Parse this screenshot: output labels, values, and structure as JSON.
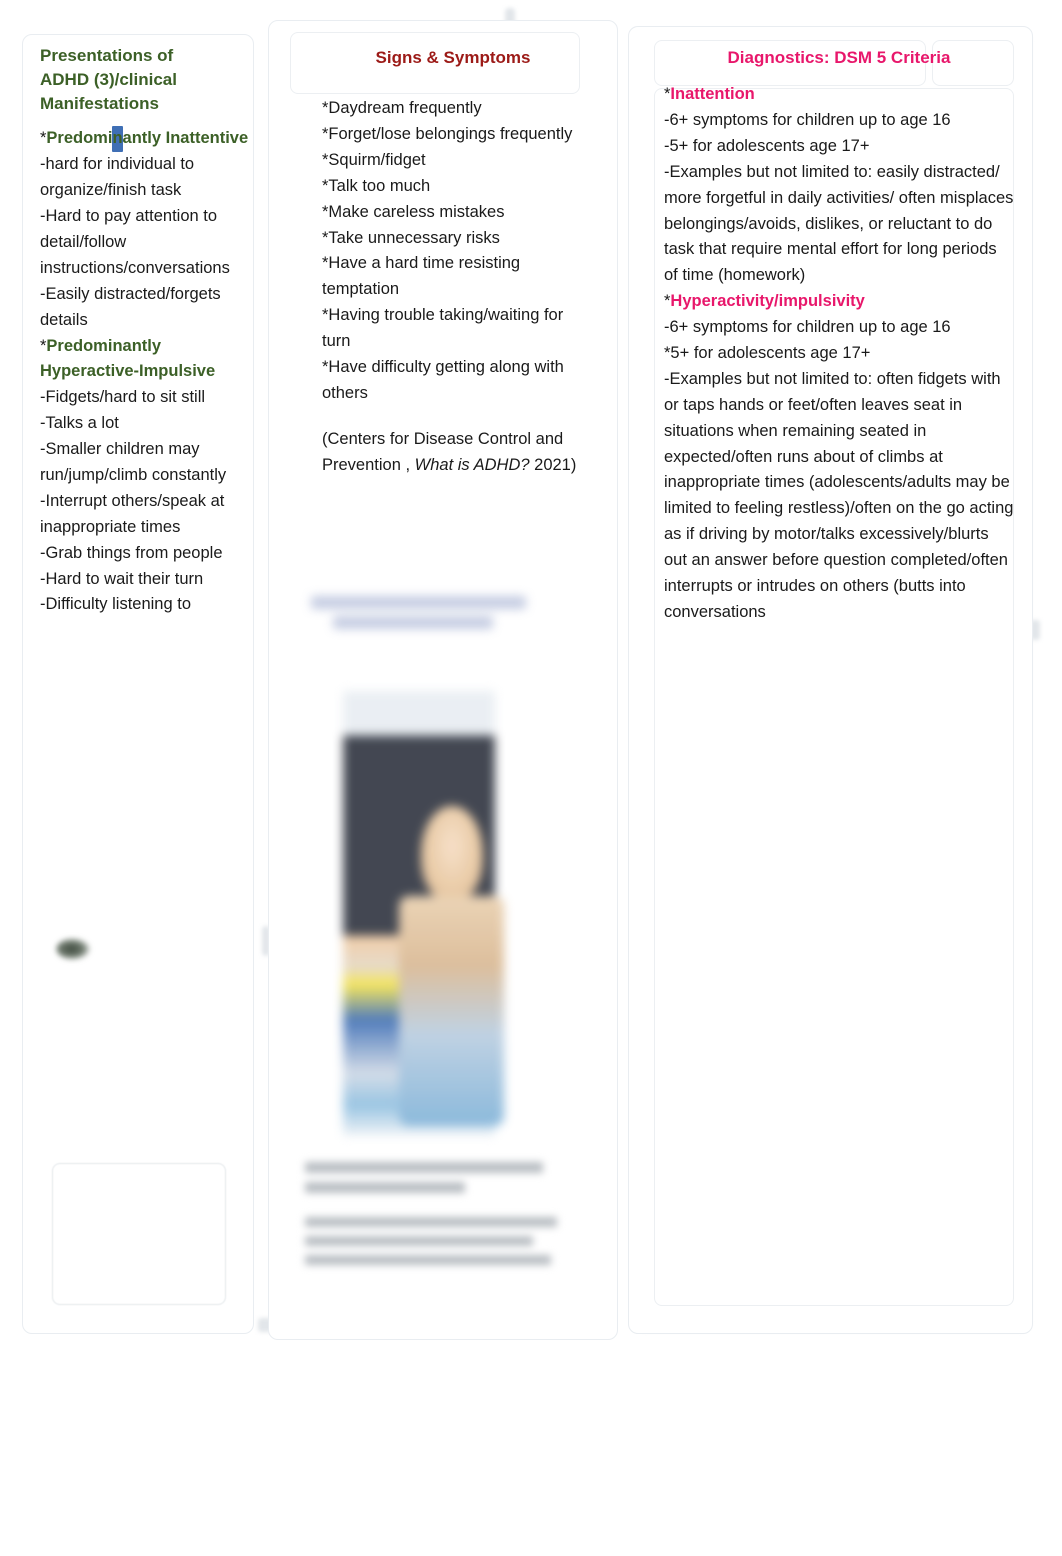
{
  "document": {
    "type": "concept-map-slide",
    "colors": {
      "green_heading": "#3c6027",
      "red_heading": "#9c1a17",
      "pink_heading": "#e8176b",
      "body_text": "#1a1a1a",
      "panel_border": "#e9edf1",
      "selection_highlight": "#3f6fb5"
    }
  },
  "left_column": {
    "title": "Presentations of ADHD (3)/clinical Manifestations",
    "section_1_heading": "Predominantly Inattentive",
    "section_1_items": [
      "-hard for individual to organize/finish task",
      "-Hard to pay attention to detail/follow instructions/conversations",
      "-Easily distracted/forgets details"
    ],
    "section_2_heading": "Predominantly Hyperactive-Impulsive",
    "section_2_items": [
      "-Fidgets/hard to sit still",
      "-Talks a lot",
      "-Smaller children may run/jump/climb constantly",
      "-Interrupt others/speak at inappropriate times",
      "-Grab things from people",
      "-Hard to wait their turn",
      "-Difficulty listening to"
    ],
    "star": "*"
  },
  "middle_column": {
    "title": "Signs & Symptoms",
    "items": [
      "*Daydream frequently",
      "*Forget/lose belongings frequently",
      "*Squirm/fidget",
      "*Talk too much",
      "*Make careless mistakes",
      "*Take unnecessary risks",
      "*Have a hard time resisting temptation",
      "*Having trouble taking/waiting for turn",
      "*Have difficulty getting along with others"
    ],
    "citation_prefix": "(Centers for Disease Control and Prevention , ",
    "citation_italic": "What is ADHD?",
    "citation_suffix": " 2021)"
  },
  "right_column": {
    "title": "Diagnostics: DSM 5 Criteria",
    "star": "*",
    "section_1_heading": "Inattention",
    "section_1_items": [
      "-6+ symptoms for children up to age 16",
      "-5+ for adolescents age 17+",
      "-Examples but not limited to: easily distracted/ more forgetful in daily activities/ often misplaces belongings/avoids, dislikes, or reluctant to do task that require mental effort for long periods of time (homework)"
    ],
    "section_2_heading": "Hyperactivity/impulsivity",
    "section_2_items": [
      "-6+ symptoms for children up to age 16",
      "*5+ for adolescents age 17+",
      "-Examples but not limited to: often fidgets with or taps hands or feet/often leaves seat in situations when remaining seated in expected/often runs about of climbs at inappropriate times (adolescents/adults may be limited to feeling restless)/often on the go acting as if driving by motor/talks excessively/blurts out an answer before question completed/often interrupts or intrudes on others (butts into conversations"
    ]
  },
  "background_elements": {
    "blurred_illustration_label": "person-with-laptop-illustration",
    "empty_placeholder_label": "empty-content-box",
    "blurred_heading_label": "obscured-blue-heading",
    "blurred_citation_label": "obscured-citation-text"
  }
}
